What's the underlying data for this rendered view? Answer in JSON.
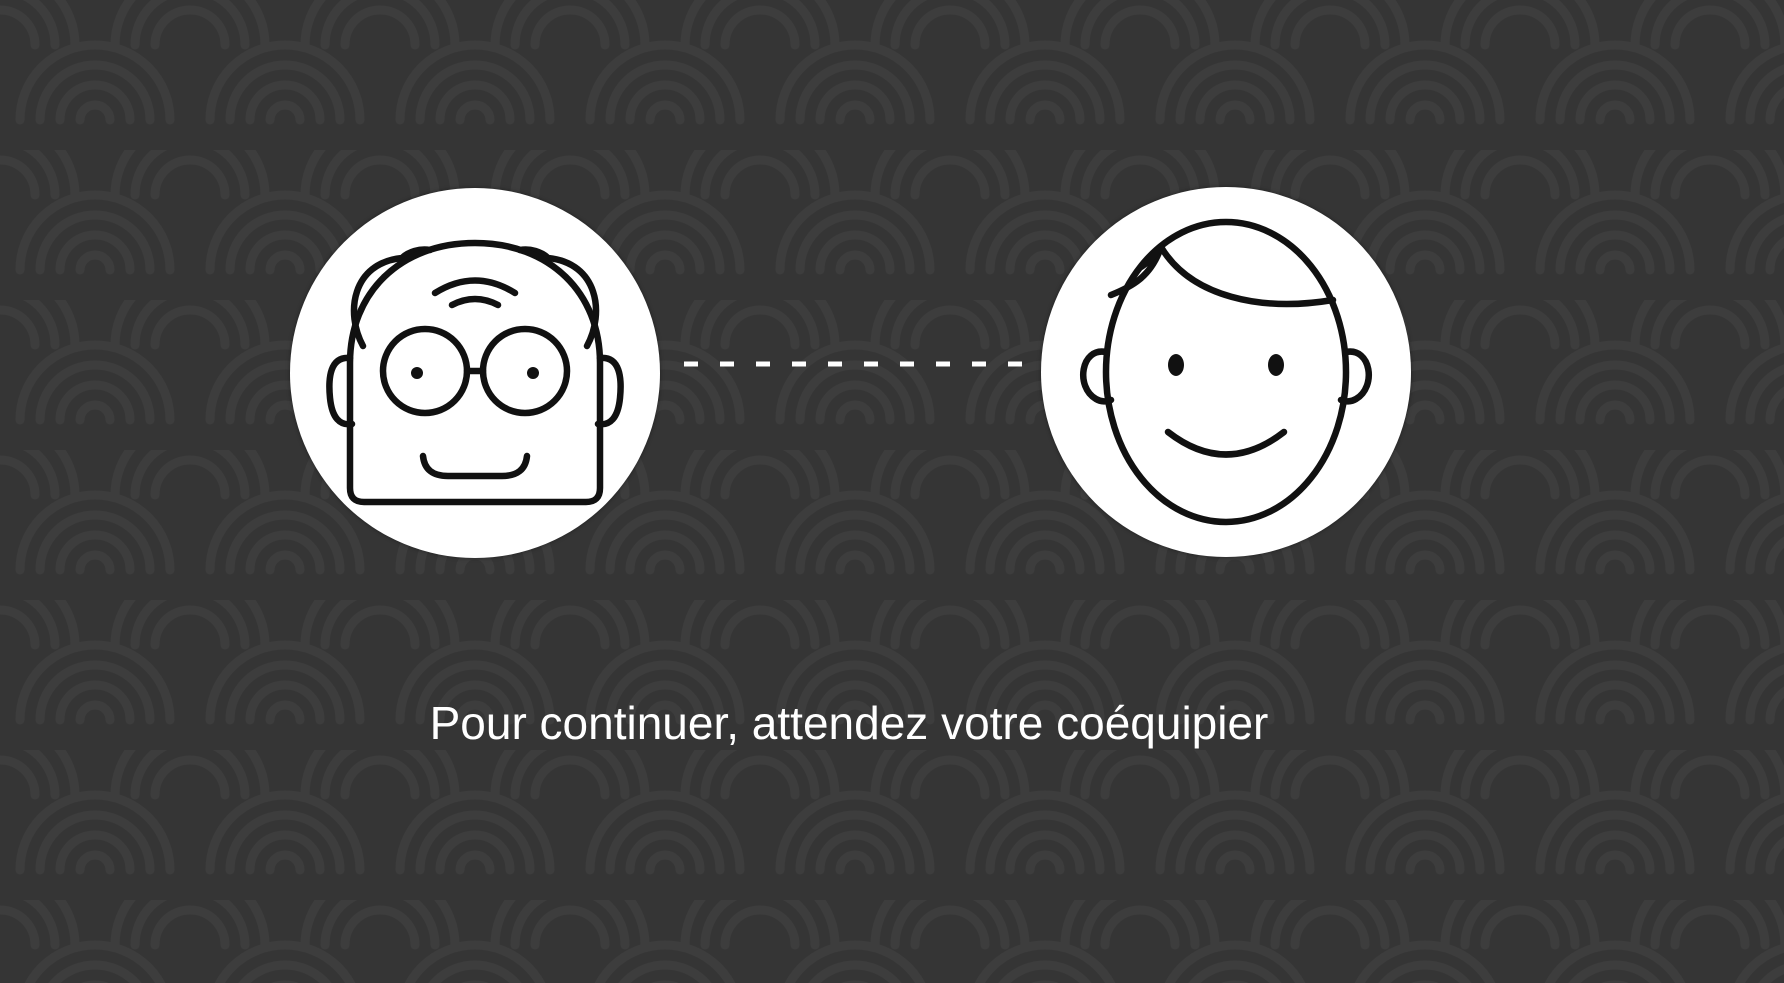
{
  "players": [
    {
      "icon": "elderly-man-with-glasses-icon",
      "role": "player"
    },
    {
      "icon": "smiling-boy-icon",
      "role": "teammate"
    }
  ],
  "status": {
    "message": "Pour continuer, attendez votre coéquipier"
  },
  "colors": {
    "background": "#353535",
    "pattern": "#3a3a3a",
    "avatar_fill": "#ffffff",
    "icon_stroke": "#111111",
    "text": "#ffffff"
  }
}
